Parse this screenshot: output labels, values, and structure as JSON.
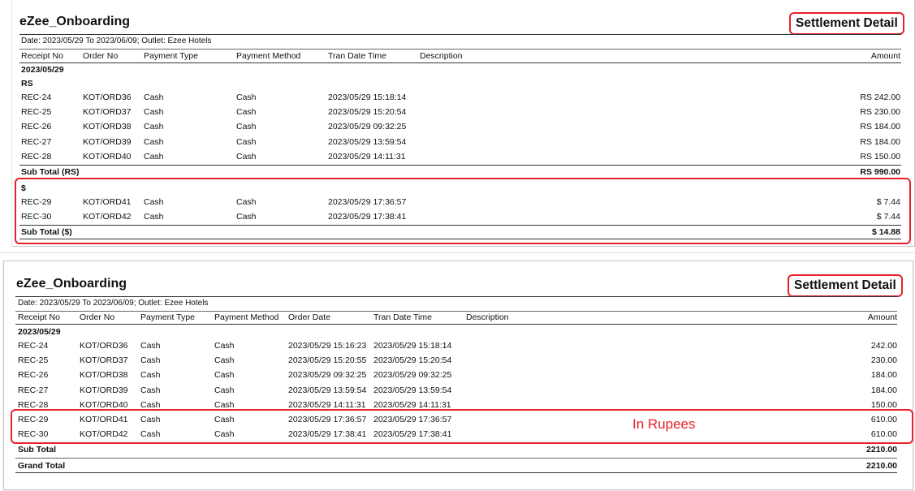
{
  "report1": {
    "company": "eZee_Onboarding",
    "badge": "Settlement Detail",
    "subtitle": "Date: 2023/05/29 To 2023/06/09; Outlet: Ezee Hotels",
    "columns": [
      "Receipt No",
      "Order No",
      "Payment Type",
      "Payment Method",
      "Tran Date Time",
      "Description",
      "Amount"
    ],
    "date_group": "2023/05/29",
    "currency_groups": [
      {
        "label": "RS",
        "rows": [
          {
            "receipt": "REC-24",
            "order": "KOT/ORD36",
            "ptype": "Cash",
            "pmethod": "Cash",
            "tran": "2023/05/29 15:18:14",
            "desc": "",
            "amount": "RS 242.00"
          },
          {
            "receipt": "REC-25",
            "order": "KOT/ORD37",
            "ptype": "Cash",
            "pmethod": "Cash",
            "tran": "2023/05/29 15:20:54",
            "desc": "",
            "amount": "RS 230.00"
          },
          {
            "receipt": "REC-26",
            "order": "KOT/ORD38",
            "ptype": "Cash",
            "pmethod": "Cash",
            "tran": "2023/05/29 09:32:25",
            "desc": "",
            "amount": "RS 184.00"
          },
          {
            "receipt": "REC-27",
            "order": "KOT/ORD39",
            "ptype": "Cash",
            "pmethod": "Cash",
            "tran": "2023/05/29 13:59:54",
            "desc": "",
            "amount": "RS 184.00"
          },
          {
            "receipt": "REC-28",
            "order": "KOT/ORD40",
            "ptype": "Cash",
            "pmethod": "Cash",
            "tran": "2023/05/29 14:11:31",
            "desc": "",
            "amount": "RS 150.00"
          }
        ],
        "subtotal_label": "Sub Total (RS)",
        "subtotal_amount": "RS 990.00"
      },
      {
        "label": "$",
        "rows": [
          {
            "receipt": "REC-29",
            "order": "KOT/ORD41",
            "ptype": "Cash",
            "pmethod": "Cash",
            "tran": "2023/05/29 17:36:57",
            "desc": "",
            "amount": "$ 7.44"
          },
          {
            "receipt": "REC-30",
            "order": "KOT/ORD42",
            "ptype": "Cash",
            "pmethod": "Cash",
            "tran": "2023/05/29 17:38:41",
            "desc": "",
            "amount": "$ 7.44"
          }
        ],
        "subtotal_label": "Sub Total ($)",
        "subtotal_amount": "$ 14.88"
      }
    ]
  },
  "report2": {
    "company": "eZee_Onboarding",
    "badge": "Settlement Detail",
    "subtitle": "Date: 2023/05/29 To 2023/06/09; Outlet: Ezee Hotels",
    "columns": [
      "Receipt No",
      "Order No",
      "Payment Type",
      "Payment Method",
      "Order Date",
      "Tran Date Time",
      "Description",
      "Amount"
    ],
    "date_group": "2023/05/29",
    "rows": [
      {
        "receipt": "REC-24",
        "order": "KOT/ORD36",
        "ptype": "Cash",
        "pmethod": "Cash",
        "odate": "2023/05/29 15:16:23",
        "tran": "2023/05/29 15:18:14",
        "desc": "",
        "amount": "242.00"
      },
      {
        "receipt": "REC-25",
        "order": "KOT/ORD37",
        "ptype": "Cash",
        "pmethod": "Cash",
        "odate": "2023/05/29 15:20:55",
        "tran": "2023/05/29 15:20:54",
        "desc": "",
        "amount": "230.00"
      },
      {
        "receipt": "REC-26",
        "order": "KOT/ORD38",
        "ptype": "Cash",
        "pmethod": "Cash",
        "odate": "2023/05/29 09:32:25",
        "tran": "2023/05/29 09:32:25",
        "desc": "",
        "amount": "184.00"
      },
      {
        "receipt": "REC-27",
        "order": "KOT/ORD39",
        "ptype": "Cash",
        "pmethod": "Cash",
        "odate": "2023/05/29 13:59:54",
        "tran": "2023/05/29 13:59:54",
        "desc": "",
        "amount": "184.00"
      },
      {
        "receipt": "REC-28",
        "order": "KOT/ORD40",
        "ptype": "Cash",
        "pmethod": "Cash",
        "odate": "2023/05/29 14:11:31",
        "tran": "2023/05/29 14:11:31",
        "desc": "",
        "amount": "150.00"
      },
      {
        "receipt": "REC-29",
        "order": "KOT/ORD41",
        "ptype": "Cash",
        "pmethod": "Cash",
        "odate": "2023/05/29 17:36:57",
        "tran": "2023/05/29 17:36:57",
        "desc": "",
        "amount": "610.00"
      },
      {
        "receipt": "REC-30",
        "order": "KOT/ORD42",
        "ptype": "Cash",
        "pmethod": "Cash",
        "odate": "2023/05/29 17:38:41",
        "tran": "2023/05/29 17:38:41",
        "desc": "",
        "amount": "610.00"
      }
    ],
    "subtotal_label": "Sub Total",
    "subtotal_amount": "2210.00",
    "grandtotal_label": "Grand Total",
    "grandtotal_amount": "2210.00",
    "annotation": "In Rupees"
  },
  "colors": {
    "highlight": "#e8202a",
    "text": "#111111"
  }
}
